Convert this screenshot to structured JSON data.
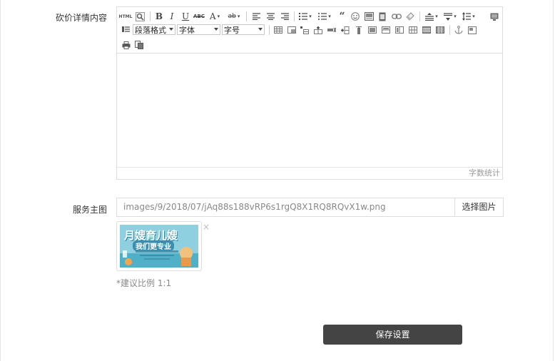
{
  "form": {
    "detail_label": "砍价详情内容",
    "image_label": "服务主图",
    "image_path": "images/9/2018/07/jAq88s188vRP6s1rgQ8X1RQ8RQvX1w.png",
    "choose_image_label": "选择图片",
    "remove_image_glyph": "×",
    "ratio_hint": "*建议比例 1:1",
    "save_label": "保存设置"
  },
  "editor": {
    "html_label": "HTML",
    "bold": "B",
    "italic": "I",
    "underline": "U",
    "strike": "ABC",
    "font_color": "A",
    "bg_color": "ab",
    "quote": "66",
    "paragraph_format": "段落格式",
    "font_family": "字体",
    "font_size": "字号",
    "word_count": "字数统计"
  },
  "thumbnail": {
    "line1": "月嫂育儿嫂",
    "line2": "我们更专业"
  },
  "colors": {
    "save_button_bg": "#444444",
    "border": "#dddddd",
    "hint_text": "#888888"
  }
}
